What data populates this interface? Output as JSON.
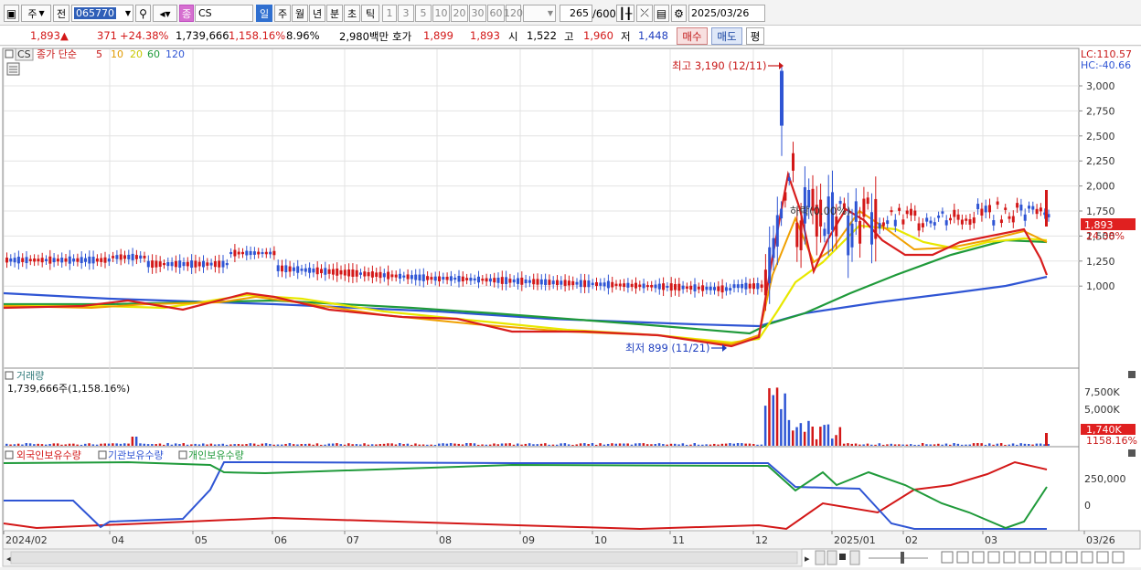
{
  "toolbar": {
    "week_label": "주",
    "prev_label": "전",
    "stock_code": "065770",
    "search_icon": "search-icon",
    "stock_name": "CS",
    "stock_tag": "종",
    "periods": [
      "일",
      "주",
      "월",
      "년",
      "분",
      "초",
      "틱"
    ],
    "selected_period": "일",
    "intervals": [
      "1",
      "3",
      "5",
      "10",
      "20",
      "30",
      "60",
      "120"
    ],
    "count": "265",
    "count_max": "/600",
    "date": "2025/03/26"
  },
  "quote": {
    "price": "1,893",
    "change_arrow": "▲",
    "change": "371",
    "change_pct": "+24.38%",
    "volume": "1,739,666",
    "volume_pct": "1,158.16%",
    "turnover": "8.96%",
    "amount": "2,980백만",
    "bid_label": "호가",
    "bid1": "1,899",
    "bid2": "1,893",
    "open_label": "시",
    "open": "1,522",
    "high_label": "고",
    "high": "1,960",
    "low_label": "저",
    "low": "1,448",
    "buy_label": "매수",
    "sell_label": "매도",
    "eval_label": "평"
  },
  "price_panel": {
    "symbol": "CS",
    "indicator_label": "종가 단순",
    "ma_periods": [
      {
        "label": "5",
        "color": "#d81e1e"
      },
      {
        "label": "10",
        "color": "#f0a000"
      },
      {
        "label": "20",
        "color": "#e8e800"
      },
      {
        "label": "60",
        "color": "#1f9a3a"
      },
      {
        "label": "120",
        "color": "#2f55d4"
      }
    ],
    "lc": "LC:110.57",
    "hc": "HC:-40.66",
    "high_note": "최고 3,190 (12/11)",
    "low_note": "최저 899 (11/21)",
    "mid_note": "하락(0.00%)",
    "current_price_tag": "1,893",
    "current_pct_tag": "24.38%",
    "y_ticks": [
      "3,000",
      "2,750",
      "2,500",
      "2,250",
      "2,000",
      "1,750",
      "1,500",
      "1,250",
      "1,000"
    ]
  },
  "volume_panel": {
    "title": "거래량",
    "value": "1,739,666주(1,158.16%)",
    "y_ticks": [
      "7,500K",
      "5,000K"
    ],
    "current_tag": "1,740K",
    "current_pct": "1158.16%"
  },
  "holding_panel": {
    "legend": [
      "외국인보유수량",
      "기관보유수량",
      "개인보유수량"
    ],
    "colors": [
      "#d31818",
      "#2f55d4",
      "#1f9a3a"
    ],
    "y_ticks": [
      "250,000",
      "0"
    ]
  },
  "x_axis": {
    "labels": [
      "2024/02",
      "04",
      "05",
      "06",
      "07",
      "08",
      "09",
      "10",
      "11",
      "12",
      "2025/01",
      "02",
      "03",
      "03/26"
    ]
  },
  "colors": {
    "up": "#d31818",
    "down": "#2f55d4",
    "accent": "#2f6fd0"
  }
}
